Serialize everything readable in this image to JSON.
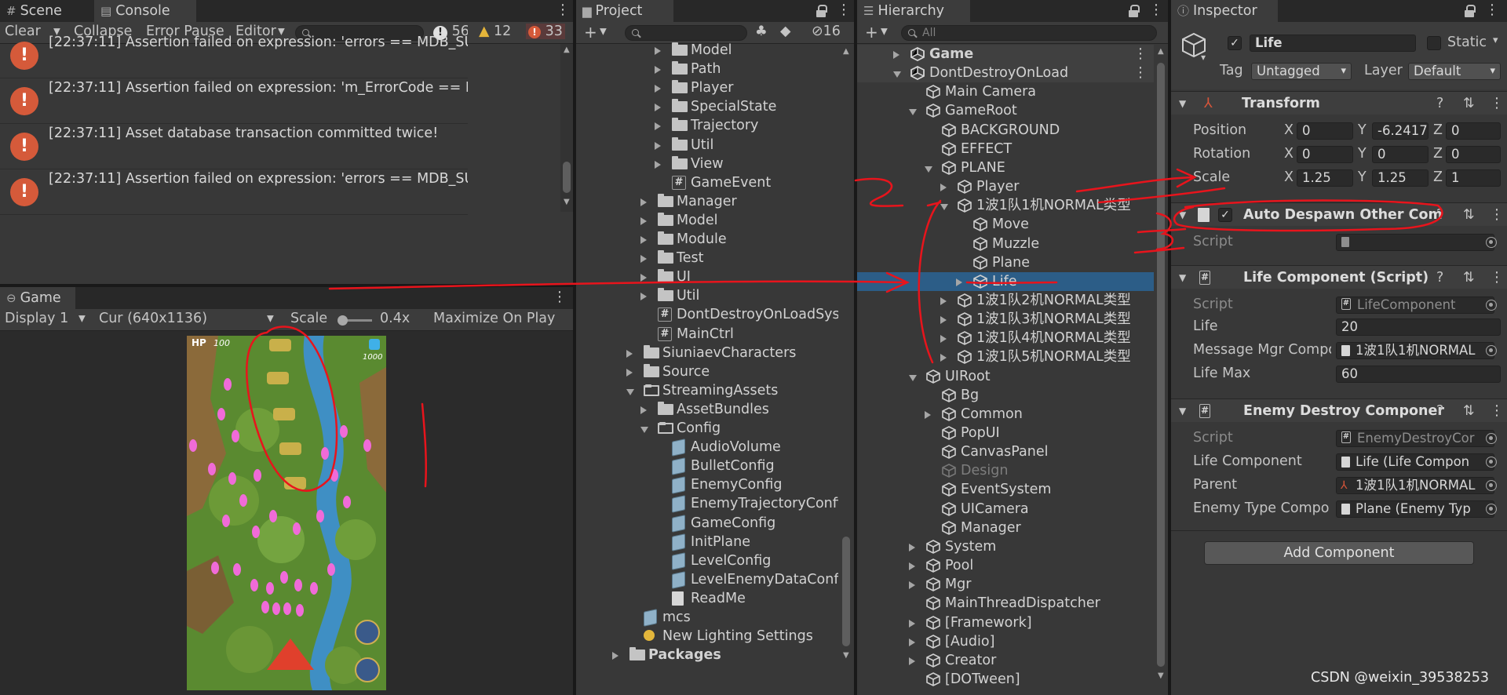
{
  "console": {
    "tabs": [
      "Scene",
      "Console"
    ],
    "toolbar": {
      "clear": "Clear",
      "collapse": "Collapse",
      "error_pause": "Error Pause",
      "editor": "Editor",
      "count_info": "56",
      "count_warn": "12",
      "count_err": "33"
    },
    "logs": [
      "[22:37:11] Assertion failed on expression: 'errors == MDB_SUCCESS || errors",
      "[22:37:11] Assertion failed on expression: 'm_ErrorCode == MDB_MAP_RESIZ",
      "[22:37:11] Asset database transaction committed twice!",
      "[22:37:11] Assertion failed on expression: 'errors == MDB_SUCCESS || errors"
    ]
  },
  "game": {
    "tab": "Game",
    "display": "Display 1",
    "resolution": "Cur (640x1136)",
    "scale_label": "Scale",
    "scale_value": "0.4x",
    "maximize": "Maximize On Play",
    "hud_hp_label": "HP",
    "hud_hp": "100",
    "hud_score": "1000"
  },
  "project": {
    "tab": "Project",
    "hidden_count": "16",
    "items": [
      {
        "label": "Model",
        "indent": 3,
        "arrow": "closed",
        "icon": "folder"
      },
      {
        "label": "Path",
        "indent": 3,
        "arrow": "closed",
        "icon": "folder"
      },
      {
        "label": "Player",
        "indent": 3,
        "arrow": "closed",
        "icon": "folder"
      },
      {
        "label": "SpecialState",
        "indent": 3,
        "arrow": "closed",
        "icon": "folder"
      },
      {
        "label": "Trajectory",
        "indent": 3,
        "arrow": "closed",
        "icon": "folder"
      },
      {
        "label": "Util",
        "indent": 3,
        "arrow": "closed",
        "icon": "folder"
      },
      {
        "label": "View",
        "indent": 3,
        "arrow": "closed",
        "icon": "folder"
      },
      {
        "label": "GameEvent",
        "indent": 3,
        "arrow": "none",
        "icon": "script"
      },
      {
        "label": "Manager",
        "indent": 2,
        "arrow": "closed",
        "icon": "folder"
      },
      {
        "label": "Model",
        "indent": 2,
        "arrow": "closed",
        "icon": "folder"
      },
      {
        "label": "Module",
        "indent": 2,
        "arrow": "closed",
        "icon": "folder"
      },
      {
        "label": "Test",
        "indent": 2,
        "arrow": "closed",
        "icon": "folder"
      },
      {
        "label": "UI",
        "indent": 2,
        "arrow": "closed",
        "icon": "folder"
      },
      {
        "label": "Util",
        "indent": 2,
        "arrow": "closed",
        "icon": "folder"
      },
      {
        "label": "DontDestroyOnLoadSystem",
        "indent": 2,
        "arrow": "none",
        "icon": "script"
      },
      {
        "label": "MainCtrl",
        "indent": 2,
        "arrow": "none",
        "icon": "script"
      },
      {
        "label": "SiuniaevCharacters",
        "indent": 1,
        "arrow": "closed",
        "icon": "folder"
      },
      {
        "label": "Source",
        "indent": 1,
        "arrow": "closed",
        "icon": "folder"
      },
      {
        "label": "StreamingAssets",
        "indent": 1,
        "arrow": "open",
        "icon": "folder-open"
      },
      {
        "label": "AssetBundles",
        "indent": 2,
        "arrow": "closed",
        "icon": "folder"
      },
      {
        "label": "Config",
        "indent": 2,
        "arrow": "open",
        "icon": "folder-open"
      },
      {
        "label": "AudioVolume",
        "indent": 3,
        "arrow": "none",
        "icon": "sobj"
      },
      {
        "label": "BulletConfig",
        "indent": 3,
        "arrow": "none",
        "icon": "sobj"
      },
      {
        "label": "EnemyConfig",
        "indent": 3,
        "arrow": "none",
        "icon": "sobj"
      },
      {
        "label": "EnemyTrajectoryConfig",
        "indent": 3,
        "arrow": "none",
        "icon": "sobj"
      },
      {
        "label": "GameConfig",
        "indent": 3,
        "arrow": "none",
        "icon": "sobj"
      },
      {
        "label": "InitPlane",
        "indent": 3,
        "arrow": "none",
        "icon": "sobj"
      },
      {
        "label": "LevelConfig",
        "indent": 3,
        "arrow": "none",
        "icon": "sobj"
      },
      {
        "label": "LevelEnemyDataConfig",
        "indent": 3,
        "arrow": "none",
        "icon": "sobj"
      },
      {
        "label": "ReadMe",
        "indent": 3,
        "arrow": "none",
        "icon": "doc"
      },
      {
        "label": "mcs",
        "indent": 1,
        "arrow": "none",
        "icon": "sobj"
      },
      {
        "label": "New Lighting Settings",
        "indent": 1,
        "arrow": "none",
        "icon": "bulb"
      },
      {
        "label": "Packages",
        "indent": 0,
        "arrow": "closed",
        "icon": "folder",
        "bold": true
      }
    ]
  },
  "hierarchy": {
    "tab": "Hierarchy",
    "search_placeholder": "All",
    "items": [
      {
        "label": "Game",
        "indent": 0,
        "arrow": "closed",
        "icon": "unity",
        "bold": true,
        "scene": true
      },
      {
        "label": "DontDestroyOnLoad",
        "indent": 0,
        "arrow": "open",
        "icon": "unity",
        "scene": true
      },
      {
        "label": "Main Camera",
        "indent": 1,
        "arrow": "none",
        "icon": "cube"
      },
      {
        "label": "GameRoot",
        "indent": 1,
        "arrow": "open",
        "icon": "cube"
      },
      {
        "label": "BACKGROUND",
        "indent": 2,
        "arrow": "none",
        "icon": "cube"
      },
      {
        "label": "EFFECT",
        "indent": 2,
        "arrow": "none",
        "icon": "cube"
      },
      {
        "label": "PLANE",
        "indent": 2,
        "arrow": "open",
        "icon": "cube"
      },
      {
        "label": "Player",
        "indent": 3,
        "arrow": "closed",
        "icon": "cube"
      },
      {
        "label": "1波1队1机NORMAL类型",
        "indent": 3,
        "arrow": "open",
        "icon": "cube"
      },
      {
        "label": "Move",
        "indent": 4,
        "arrow": "none",
        "icon": "cube"
      },
      {
        "label": "Muzzle",
        "indent": 4,
        "arrow": "none",
        "icon": "cube"
      },
      {
        "label": "Plane",
        "indent": 4,
        "arrow": "none",
        "icon": "cube"
      },
      {
        "label": "Life",
        "indent": 4,
        "arrow": "closed",
        "icon": "cube",
        "selected": true
      },
      {
        "label": "1波1队2机NORMAL类型",
        "indent": 3,
        "arrow": "closed",
        "icon": "cube"
      },
      {
        "label": "1波1队3机NORMAL类型",
        "indent": 3,
        "arrow": "closed",
        "icon": "cube"
      },
      {
        "label": "1波1队4机NORMAL类型",
        "indent": 3,
        "arrow": "closed",
        "icon": "cube"
      },
      {
        "label": "1波1队5机NORMAL类型",
        "indent": 3,
        "arrow": "closed",
        "icon": "cube"
      },
      {
        "label": "UIRoot",
        "indent": 1,
        "arrow": "open",
        "icon": "cube"
      },
      {
        "label": "Bg",
        "indent": 2,
        "arrow": "none",
        "icon": "cube"
      },
      {
        "label": "Common",
        "indent": 2,
        "arrow": "closed",
        "icon": "cube"
      },
      {
        "label": "PopUI",
        "indent": 2,
        "arrow": "none",
        "icon": "cube"
      },
      {
        "label": "CanvasPanel",
        "indent": 2,
        "arrow": "none",
        "icon": "cube"
      },
      {
        "label": "Design",
        "indent": 2,
        "arrow": "none",
        "icon": "cube",
        "dim": true
      },
      {
        "label": "EventSystem",
        "indent": 2,
        "arrow": "none",
        "icon": "cube"
      },
      {
        "label": "UICamera",
        "indent": 2,
        "arrow": "none",
        "icon": "cube"
      },
      {
        "label": "Manager",
        "indent": 2,
        "arrow": "none",
        "icon": "cube"
      },
      {
        "label": "System",
        "indent": 1,
        "arrow": "closed",
        "icon": "cube"
      },
      {
        "label": "Pool",
        "indent": 1,
        "arrow": "closed",
        "icon": "cube"
      },
      {
        "label": "Mgr",
        "indent": 1,
        "arrow": "closed",
        "icon": "cube"
      },
      {
        "label": "MainThreadDispatcher",
        "indent": 1,
        "arrow": "none",
        "icon": "cube"
      },
      {
        "label": "[Framework]",
        "indent": 1,
        "arrow": "closed",
        "icon": "cube"
      },
      {
        "label": "[Audio]",
        "indent": 1,
        "arrow": "closed",
        "icon": "cube"
      },
      {
        "label": "Creator",
        "indent": 1,
        "arrow": "closed",
        "icon": "cube"
      },
      {
        "label": "[DOTween]",
        "indent": 1,
        "arrow": "none",
        "icon": "cube"
      }
    ]
  },
  "inspector": {
    "tab": "Inspector",
    "object_name": "Life",
    "static_label": "Static",
    "tag_label": "Tag",
    "tag_value": "Untagged",
    "layer_label": "Layer",
    "layer_value": "Default",
    "transform": {
      "title": "Transform",
      "position_label": "Position",
      "rotation_label": "Rotation",
      "scale_label": "Scale",
      "x": "X",
      "y": "Y",
      "z": "Z",
      "position": [
        "0",
        "-6.2417",
        "0"
      ],
      "rotation": [
        "0",
        "0",
        "0"
      ],
      "scale": [
        "1.25",
        "1.25",
        "1"
      ]
    },
    "auto_despawn": {
      "title": "Auto Despawn Other Com",
      "script_label": "Script"
    },
    "life_component": {
      "title": "Life Component (Script)",
      "script_label": "Script",
      "script_value": "LifeComponent",
      "life_label": "Life",
      "life_value": "20",
      "msg_label": "Message Mgr Compo",
      "msg_value": "1波1队1机NORMAL",
      "lifemax_label": "Life Max",
      "lifemax_value": "60"
    },
    "enemy_destroy": {
      "title": "Enemy Destroy Componer",
      "script_label": "Script",
      "script_value": "EnemyDestroyCor",
      "life_comp_label": "Life Component",
      "life_comp_value": "Life (Life Compon",
      "parent_label": "Parent",
      "parent_value": "1波1队1机NORMAL",
      "type_label": "Enemy Type Compo",
      "type_value": "Plane (Enemy Typ"
    },
    "add_component": "Add Component"
  },
  "watermark": "CSDN @weixin_39538253",
  "colors": {
    "accent_select": "#2c5d87",
    "annotation": "#e8141c",
    "error": "#d55a3a"
  }
}
